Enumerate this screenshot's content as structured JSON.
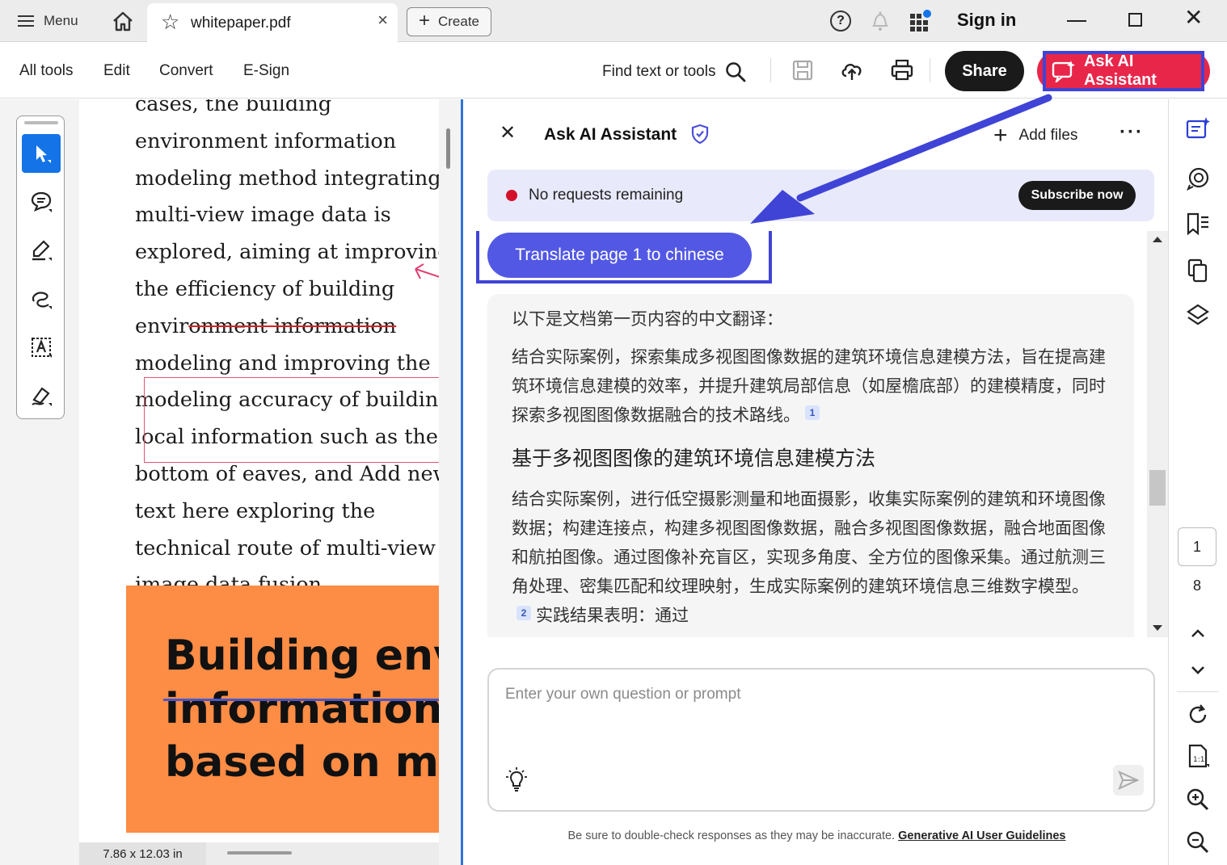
{
  "titlebar": {
    "menu_label": "Menu",
    "tab_title": "whitepaper.pdf",
    "create_label": "Create",
    "signin_label": "Sign in"
  },
  "toolbar": {
    "nav": [
      "All tools",
      "Edit",
      "Convert",
      "E-Sign"
    ],
    "find_label": "Find text or tools",
    "share_label": "Share",
    "ask_ai_label": "Ask AI Assistant"
  },
  "document": {
    "lines": [
      "cases, the building",
      "environment information",
      "modeling method integrating",
      "multi-view image data is",
      "explored, aiming at improving",
      "the efficiency of building",
      "environment information",
      "modeling and improving the",
      "modeling accuracy of building",
      "local information such as the",
      "bottom of eaves, and Add new",
      "text  here exploring the",
      "technical route of multi-view",
      "image data fusion."
    ],
    "strike_prefix": "envir",
    "strike_text": "onment information",
    "cover_lines": [
      "Building envi",
      "information",
      "based on mul"
    ],
    "page_size": "7.86 x 12.03 in"
  },
  "ai_panel": {
    "title": "Ask AI Assistant",
    "add_files_label": "Add files",
    "banner_text": "No requests remaining",
    "subscribe_label": "Subscribe now",
    "prompt_chip": "Translate page 1 to chinese",
    "response": {
      "intro": "以下是文档第一页内容的中文翻译：",
      "p1": "结合实际案例，探索集成多视图图像数据的建筑环境信息建模方法，旨在提高建筑环境信息建模的效率，并提升建筑局部信息（如屋檐底部）的建模精度，同时探索多视图图像数据融合的技术路线。",
      "cite1": "1",
      "heading": "基于多视图图像的建筑环境信息建模方法",
      "p2": "结合实际案例，进行低空摄影测量和地面摄影，收集实际案例的建筑和环境图像数据；构建连接点，构建多视图图像数据，融合多视图图像数据，融合地面图像和航拍图像。通过图像补充盲区，实现多角度、全方位的图像采集。通过航测三角处理、密集匹配和纹理映射，生成实际案例的建筑环境信息三维数字模型。",
      "cite2": "2",
      "p2_tail": "实践结果表明：通过"
    },
    "input_placeholder": "Enter your own question or prompt",
    "disclaimer": "Be sure to double-check responses as they may be inaccurate. ",
    "guidelines_link": "Generative AI User Guidelines"
  },
  "right_rail": {
    "current_page": "1",
    "total_pages": "8"
  },
  "colors": {
    "accent_blue": "#1473e6",
    "ai_red": "#e8264a",
    "annotation_blue": "#3f44d6",
    "chip_purple": "#5258e4",
    "cover_orange": "#fd8c45"
  }
}
